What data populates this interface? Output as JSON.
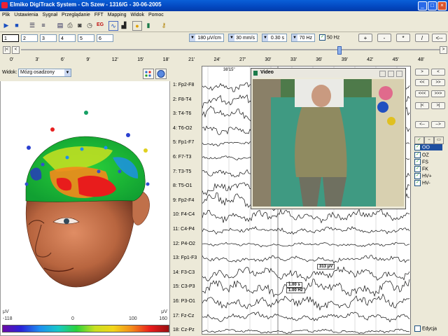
{
  "window": {
    "title": "Elmiko DigiTrack System  -  Ch Szew  -  1316/G  -  30-06-2005",
    "controls": [
      "_",
      "□",
      "×"
    ]
  },
  "menu": [
    "Plik",
    "Ustawienia",
    "Sygnał",
    "Przeglądanie",
    "FFT",
    "Mapping",
    "Widok",
    "Pomoc"
  ],
  "toolbar": {
    "icons": [
      "play-icon",
      "stop-icon",
      "list-icon",
      "list-alt-icon",
      "print-preview-icon",
      "print-icon",
      "camera-icon",
      "clock-icon",
      "eg-icon",
      "montage-icon",
      "spectrum-icon",
      "map-icon",
      "video-icon",
      "key-icon"
    ],
    "eg_label": "EG"
  },
  "pages": {
    "tabs": [
      "1",
      "2",
      "3",
      "4",
      "5",
      "6"
    ],
    "selected": "1"
  },
  "signal_settings": {
    "sensitivity": "180 μV/cm",
    "speed": "30 mm/s",
    "low_filter": "0.30 s",
    "high_filter": "70 Hz",
    "notch_checked": true,
    "notch_label": "50 Hz"
  },
  "amp_buttons": [
    "+",
    "-",
    "*",
    "/",
    "<--"
  ],
  "timeline": {
    "ticks": [
      "0'",
      "3'",
      "6'",
      "9'",
      "12'",
      "15'",
      "18'",
      "21'",
      "24'",
      "27'",
      "30'",
      "33'",
      "36'",
      "39'",
      "42'",
      "45'",
      "48'"
    ]
  },
  "view": {
    "label": "Widok:",
    "value": "Mózg osadzony"
  },
  "scale": {
    "unit_left": "μV",
    "unit_right": "μV",
    "min": "-118",
    "zero": "0",
    "mid": "100",
    "max": "160",
    "colors": [
      "#6a0aa8",
      "#2a23d8",
      "#1e8ef0",
      "#18c8c8",
      "#2ad23a",
      "#c9e021",
      "#f2d51a",
      "#f38a1b",
      "#e81c1c",
      "#9a0f12"
    ]
  },
  "eeg": {
    "time_marker": "38'15\"",
    "channels": [
      "1: Fp2-F8",
      "2: F8-T4",
      "3: T4-T6",
      "4: T6-O2",
      "5: Fp1-F7",
      "6: F7-T3",
      "7: T3-T5",
      "8: T5-O1",
      "9: Fp2-F4",
      "10: F4-C4",
      "11: C4-P4",
      "12: P4-O2",
      "13: Fp1-F3",
      "14: F3-C3",
      "15: C3-P3",
      "16: P3-O1",
      "17: Fz-Cz",
      "18: Cz-Pz"
    ],
    "annotations": {
      "amplitude": "313 μV",
      "time": "1.00 s",
      "freq": "1.00 Hz"
    }
  },
  "video": {
    "title": "Video"
  },
  "nav_buttons": [
    ">",
    "<",
    "<<",
    ">>",
    "<<<",
    ">>>",
    "|<",
    ">|",
    "<--",
    "-->"
  ],
  "events": {
    "header_icons": [
      "check-icon",
      "minus-icon",
      "rect-icon"
    ],
    "items": [
      {
        "label": "OO",
        "checked": true,
        "selected": true
      },
      {
        "label": "OZ",
        "checked": true,
        "selected": false
      },
      {
        "label": "FS",
        "checked": true,
        "selected": false
      },
      {
        "label": "FK",
        "checked": true,
        "selected": false
      },
      {
        "label": "HV+",
        "checked": true,
        "selected": false
      },
      {
        "label": "HV-",
        "checked": true,
        "selected": false
      }
    ],
    "edit_label": "Edycja",
    "edit_checked": false
  }
}
